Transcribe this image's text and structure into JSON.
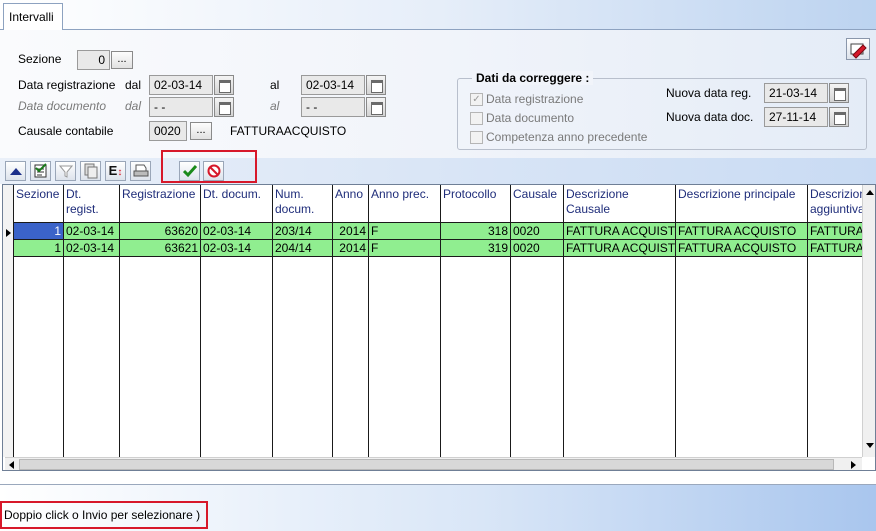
{
  "tab": {
    "label": "Intervalli"
  },
  "filters": {
    "sezione_label": "Sezione",
    "sezione_value": "0",
    "ellipsis": "...",
    "data_reg_label": "Data registrazione",
    "data_reg_dal": "dal",
    "data_reg_from": "02-03-14",
    "data_reg_al": "al",
    "data_reg_to": "02-03-14",
    "data_doc_label": "Data documento",
    "data_doc_dal": "dal",
    "data_doc_from": "- -",
    "data_doc_al": "al",
    "data_doc_to": "- -",
    "causale_label": "Causale contabile",
    "causale_value": "0020",
    "causale_desc": "FATTURAACQUISTO"
  },
  "corrections": {
    "title": "Dati da correggere :",
    "chk_data_reg": "Data registrazione",
    "chk_data_doc": "Data documento",
    "chk_competenza": "Competenza anno precedente",
    "nuova_data_reg_label": "Nuova data reg.",
    "nuova_data_reg_value": "21-03-14",
    "nuova_data_doc_label": "Nuova data doc.",
    "nuova_data_doc_value": "27-11-14"
  },
  "grid": {
    "headers": [
      "Sezione",
      "Dt. regist.",
      "Registrazione",
      "Dt. docum.",
      "Num. docum.",
      "Anno",
      "Anno prec.",
      "Protocollo",
      "Causale",
      "Descrizione Causale",
      "Descrizione principale",
      "Descrizione aggiuntiva"
    ],
    "rows": [
      [
        "1",
        "02-03-14",
        "63620",
        "02-03-14",
        "203/14",
        "2014",
        "F",
        "318",
        "0020",
        "FATTURA ACQUISTO",
        "FATTURA ACQUISTO",
        "FATTURA"
      ],
      [
        "1",
        "02-03-14",
        "63621",
        "02-03-14",
        "204/14",
        "2014",
        "F",
        "319",
        "0020",
        "FATTURA ACQUISTO",
        "FATTURA ACQUISTO",
        "FATTURA"
      ]
    ]
  },
  "status": {
    "text": "Doppio click o Invio per selezionare )"
  },
  "colors": {
    "row_green": "#90ee90",
    "accent_red": "#d7182a",
    "header_text": "#1f2d7a"
  }
}
